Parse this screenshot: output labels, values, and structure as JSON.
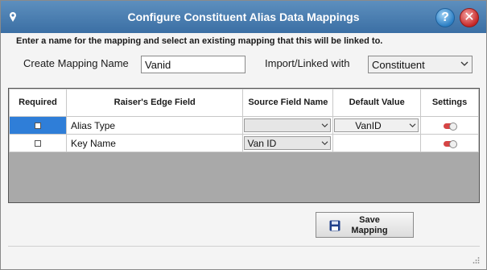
{
  "window": {
    "title": "Configure Constituent Alias Data Mappings",
    "help_label": "?",
    "close_label": "✕"
  },
  "instructions": "Enter a name for the mapping and select an existing mapping that this will be linked to.",
  "form": {
    "mapping_name_label": "Create Mapping Name",
    "mapping_name_value": "Vanid",
    "import_linked_label": "Import/Linked with",
    "import_linked_value": "Constituent"
  },
  "grid": {
    "columns": [
      "Required",
      "Raiser's Edge Field",
      "Source Field Name",
      "Default Value",
      "Settings"
    ],
    "rows": [
      {
        "required": false,
        "field": "Alias Type",
        "source": "",
        "default": "VanID",
        "selected": true
      },
      {
        "required": false,
        "field": "Key Name",
        "source": "Van ID",
        "default": "",
        "selected": false
      }
    ]
  },
  "save_button": {
    "label_line1": "Save",
    "label_line2": "Mapping"
  },
  "colors": {
    "titlebar": "#3b6fa4",
    "selection": "#2f7ed8",
    "toggle": "#d64545"
  }
}
